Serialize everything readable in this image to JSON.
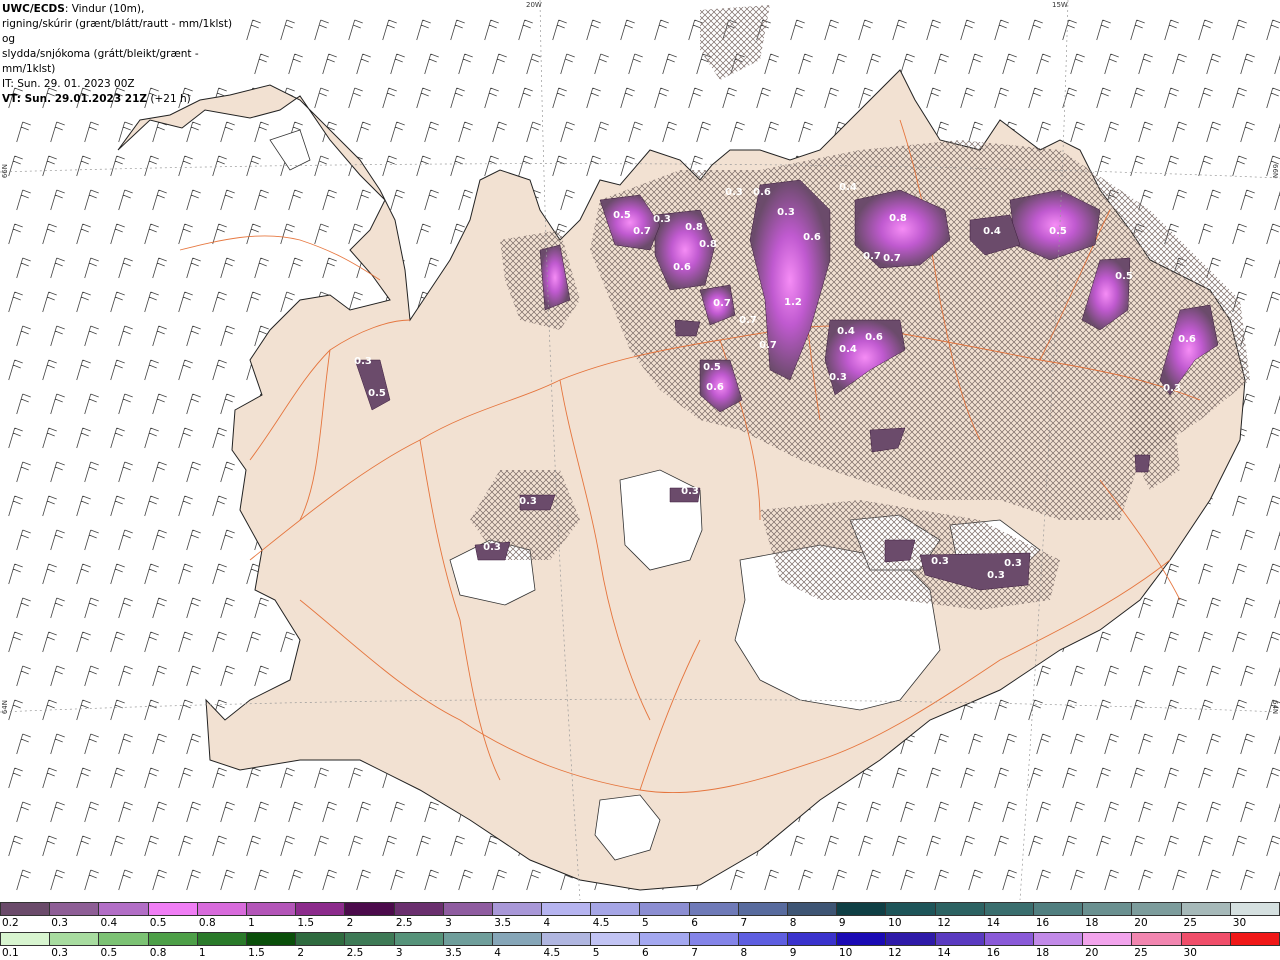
{
  "header": {
    "title_bold": "UWC/ECDS",
    "title_rest": ": Vindur (10m),",
    "line2": "rigning/skúrir (grænt/blátt/rautt - mm/1klst) og",
    "line3": "slydda/snjókoma (grátt/bleikt/grænt - mm/1klst)",
    "it": "IT: Sun. 29. 01. 2023 00Z",
    "vt_bold": "VT: Sun. 29.01.2023 21Z",
    "vt_rest": " (+21 h)"
  },
  "coords": {
    "top1": "20W",
    "top2": "15W",
    "left1": "66N",
    "left2": "64N",
    "right1": "66N",
    "right2": "64N"
  },
  "precip_labels": [
    "0.5",
    "0.3",
    "0.7",
    "0.8",
    "0.8",
    "0.6",
    "0.3",
    "0.6",
    "0.3",
    "0.4",
    "0.8",
    "0.4",
    "0.5",
    "0.6",
    "1.2",
    "0.7",
    "0.7",
    "0.7",
    "0.6",
    "0.4",
    "0.4",
    "0.6",
    "0.3",
    "0.5",
    "0.5",
    "0.6",
    "0.3",
    "0.5",
    "0.3",
    "0.3",
    "0.3",
    "0.3",
    "0.3",
    "0.3",
    "0.3",
    "0.7",
    "0.7"
  ],
  "legend": {
    "snow_colors": [
      "#6b4b6b",
      "#8e5e96",
      "#b26ec6",
      "#f07ef5",
      "#d86bdc",
      "#b355b8",
      "#8c2b8c",
      "#4b0a4b",
      "#6a2f6e",
      "#8f5ca0",
      "#a998d8",
      "#b6b4f0",
      "#a6a6e6",
      "#8c8ed2",
      "#6f7ab8",
      "#586b9e",
      "#3e5574",
      "#0f3f45",
      "#1e5559",
      "#2c6262",
      "#3a6e6e",
      "#517f80",
      "#6a9090",
      "#7c9c9c",
      "#a6b9b9",
      "#d5e0e0"
    ],
    "snow_labels": [
      "0.2",
      "0.3",
      "0.4",
      "0.5",
      "0.8",
      "1",
      "1.5",
      "2",
      "2.5",
      "3",
      "3.5",
      "4",
      "4.5",
      "5",
      "6",
      "7",
      "8",
      "9",
      "10",
      "12",
      "14",
      "16",
      "18",
      "20",
      "25",
      "30"
    ],
    "rain_colors": [
      "#d8f5d0",
      "#a8dca0",
      "#7cc274",
      "#4d9f48",
      "#2a7a2a",
      "#0a4f0a",
      "#2f6b3f",
      "#3e7a56",
      "#56937a",
      "#6f9e9b",
      "#86a6b8",
      "#b0b6e0",
      "#c2c4f4",
      "#a4a8f0",
      "#8484e8",
      "#5e5ee0",
      "#3a32cc",
      "#1a0ab4",
      "#2e1aa8",
      "#5a3ac0",
      "#8a5ad8",
      "#c28ae8",
      "#f2a4ec",
      "#f286b0",
      "#f04e6a",
      "#f01818"
    ],
    "rain_labels": [
      "0.1",
      "0.3",
      "0.5",
      "0.8",
      "1",
      "1.5",
      "2",
      "2.5",
      "3",
      "3.5",
      "4",
      "4.5",
      "5",
      "6",
      "7",
      "8",
      "9",
      "10",
      "12",
      "14",
      "16",
      "18",
      "20",
      "25",
      "30"
    ]
  }
}
